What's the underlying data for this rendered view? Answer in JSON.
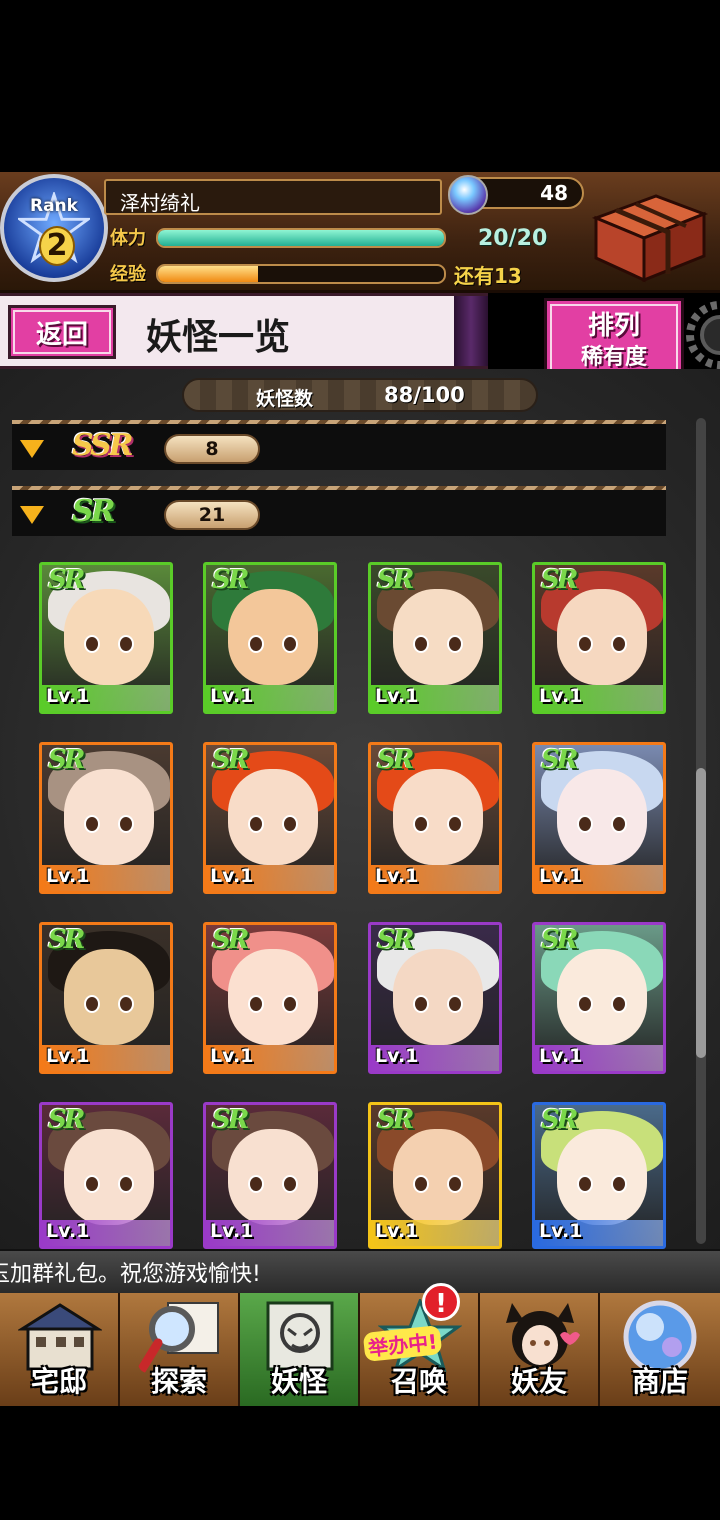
{
  "header": {
    "rank_label": "Rank",
    "rank_value": "2",
    "player_name": "泽村绮礼",
    "stamina_label": "体力",
    "stamina_value": "20/20",
    "stamina_fill": 1.0,
    "xp_label": "经验",
    "xp_remaining": "还有13",
    "xp_fill": 0.35,
    "gem_count": "48",
    "icons": {
      "gem": "magic-orb-icon",
      "chest": "treasure-chest-icon"
    }
  },
  "title_bar": {
    "back_label": "返回",
    "title": "妖怪一览",
    "sort_label": "排列",
    "sort_value": "稀有度"
  },
  "monster_count": {
    "label": "妖怪数",
    "value": "88/100"
  },
  "groups": [
    {
      "rarity": "SSR",
      "count": "8"
    },
    {
      "rarity": "SR",
      "count": "21"
    }
  ],
  "cards": [
    {
      "rarity": "SR",
      "level": "Lv.1",
      "frame": "#5acc28",
      "hair": "#e8e4e0",
      "skin": "#f7d9b8",
      "bg": "#5a8a3a"
    },
    {
      "rarity": "SR",
      "level": "Lv.1",
      "frame": "#5acc28",
      "hair": "#2e7a3a",
      "skin": "#f3c79a",
      "bg": "#4a6a30"
    },
    {
      "rarity": "SR",
      "level": "Lv.1",
      "frame": "#5acc28",
      "hair": "#6a4a32",
      "skin": "#f6dcc4",
      "bg": "#3a4a2a"
    },
    {
      "rarity": "SR",
      "level": "Lv.1",
      "frame": "#5acc28",
      "hair": "#b83a2e",
      "skin": "#f6d8c0",
      "bg": "#5a3a2a"
    },
    {
      "rarity": "SR",
      "level": "Lv.1",
      "frame": "#f47a18",
      "hair": "#a89282",
      "skin": "#f8e0d0",
      "bg": "#4a3a30"
    },
    {
      "rarity": "SR",
      "level": "Lv.1",
      "frame": "#f47a18",
      "hair": "#e44a18",
      "skin": "#f8dcc8",
      "bg": "#6a4a38"
    },
    {
      "rarity": "SR",
      "level": "Lv.1",
      "frame": "#f47a18",
      "hair": "#e44a18",
      "skin": "#f8dcc8",
      "bg": "#6a4a38"
    },
    {
      "rarity": "SR",
      "level": "Lv.1",
      "frame": "#f47a18",
      "hair": "#c8d8f0",
      "skin": "#f8e8e8",
      "bg": "#7a8ab0"
    },
    {
      "rarity": "SR",
      "level": "Lv.1",
      "frame": "#f47a18",
      "hair": "#1e1814",
      "skin": "#e8c89a",
      "bg": "#3a3028"
    },
    {
      "rarity": "SR",
      "level": "Lv.1",
      "frame": "#f47a18",
      "hair": "#f0908a",
      "skin": "#fbe0d0",
      "bg": "#7a3a3a"
    },
    {
      "rarity": "SR",
      "level": "Lv.1",
      "frame": "#9a3ac8",
      "hair": "#e8e8e8",
      "skin": "#f4d8c4",
      "bg": "#3a2a4a"
    },
    {
      "rarity": "SR",
      "level": "Lv.1",
      "frame": "#9a3ac8",
      "hair": "#8ad8b8",
      "skin": "#faeadc",
      "bg": "#6a9a88"
    },
    {
      "rarity": "SR",
      "level": "Lv.1",
      "frame": "#9a3ac8",
      "hair": "#6a4a3e",
      "skin": "#f8e0d0",
      "bg": "#5a2a3a"
    },
    {
      "rarity": "SR",
      "level": "Lv.1",
      "frame": "#9a3ac8",
      "hair": "#6a4a3e",
      "skin": "#f8e0d0",
      "bg": "#5a2a3a"
    },
    {
      "rarity": "SR",
      "level": "Lv.1",
      "frame": "#f4c418",
      "hair": "#8a4a2a",
      "skin": "#f4d0b0",
      "bg": "#5a3a2a"
    },
    {
      "rarity": "SR",
      "level": "Lv.1",
      "frame": "#2a6ae0",
      "hair": "#c8e07a",
      "skin": "#faeadc",
      "bg": "#4a6a8a"
    }
  ],
  "ticker": {
    "text": "玉加群礼包。祝您游戏愉快!"
  },
  "nav": [
    {
      "label": "宅邸",
      "icon": "mansion-icon"
    },
    {
      "label": "探索",
      "icon": "magnifier-map-icon"
    },
    {
      "label": "妖怪",
      "icon": "monster-scroll-icon"
    },
    {
      "label": "召唤",
      "icon": "summon-star-icon",
      "badge": "举办中!",
      "alert": "!"
    },
    {
      "label": "妖友",
      "icon": "friend-catgirl-icon"
    },
    {
      "label": "商店",
      "icon": "shop-orb-icon"
    }
  ],
  "colors": {
    "accent_pink": "#e23fa3",
    "stamina": "#22b093",
    "xp": "#f08a12"
  }
}
